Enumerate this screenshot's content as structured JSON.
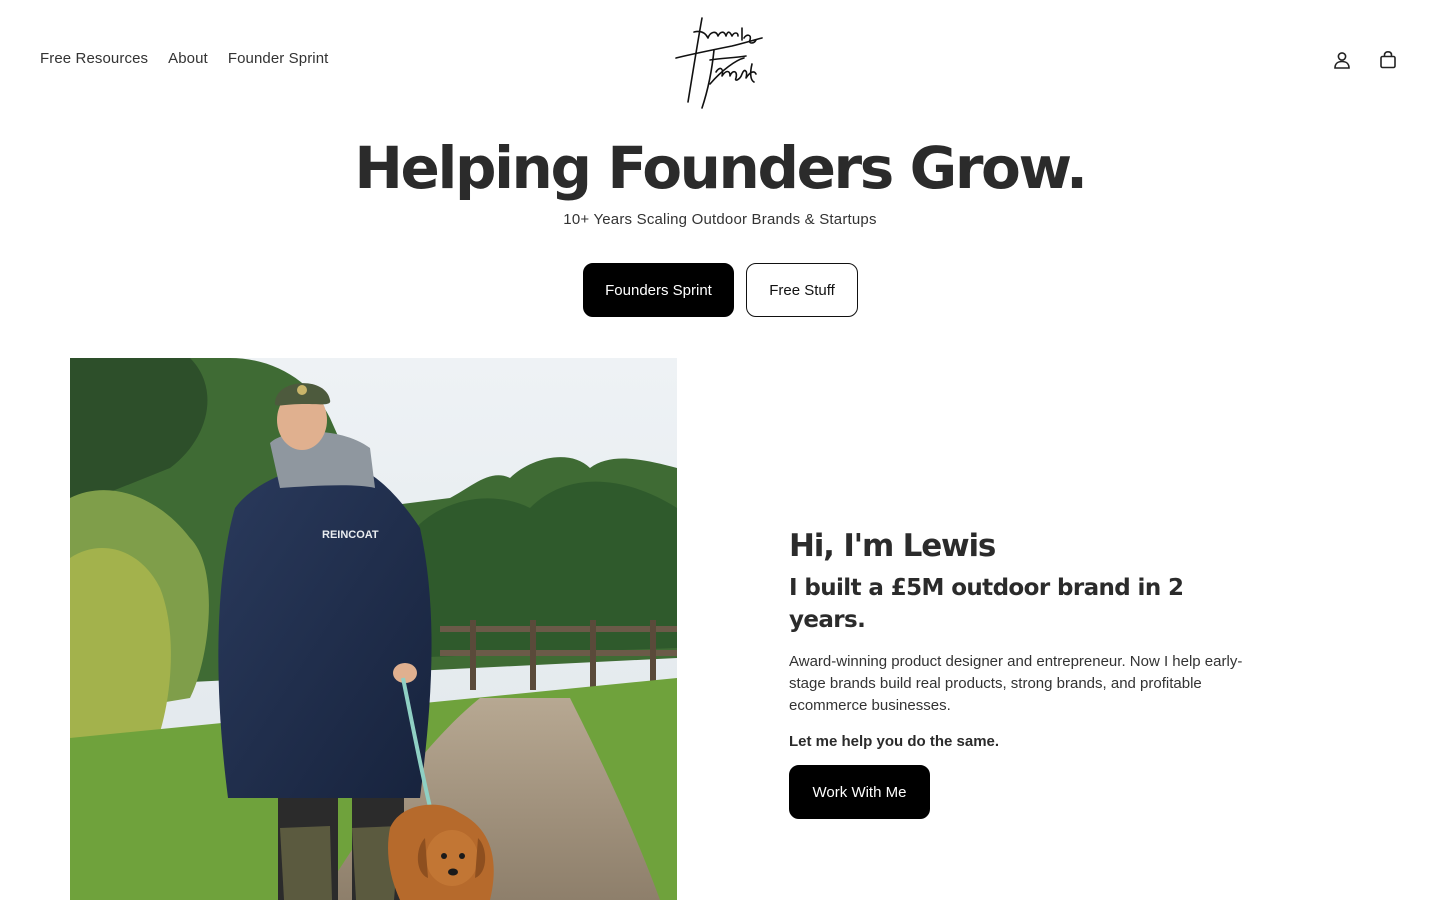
{
  "header": {
    "nav": [
      {
        "label": "Free Resources"
      },
      {
        "label": "About"
      },
      {
        "label": "Founder Sprint"
      }
    ],
    "logo_text": "Lewis Frost",
    "icons": [
      "account-icon",
      "cart-icon"
    ]
  },
  "hero": {
    "title": "Helping Founders Grow.",
    "subtitle": "10+ Years Scaling Outdoor Brands & Startups",
    "primary_button": "Founders Sprint",
    "secondary_button": "Free Stuff"
  },
  "intro": {
    "heading": "Hi, I'm Lewis",
    "subheading": "I built a £5M outdoor brand in 2 years.",
    "description": "Award-winning product designer and entrepreneur. Now I help early-stage brands build real products, strong brands, and profitable ecommerce businesses.",
    "cta_lead": "Let me help you do the same.",
    "cta_button": "Work With Me"
  },
  "photo": {
    "jacket_text": "REINCOAT"
  },
  "colors": {
    "primary_button_bg": "#000000",
    "text": "#2b2b2b",
    "background": "#ffffff"
  }
}
